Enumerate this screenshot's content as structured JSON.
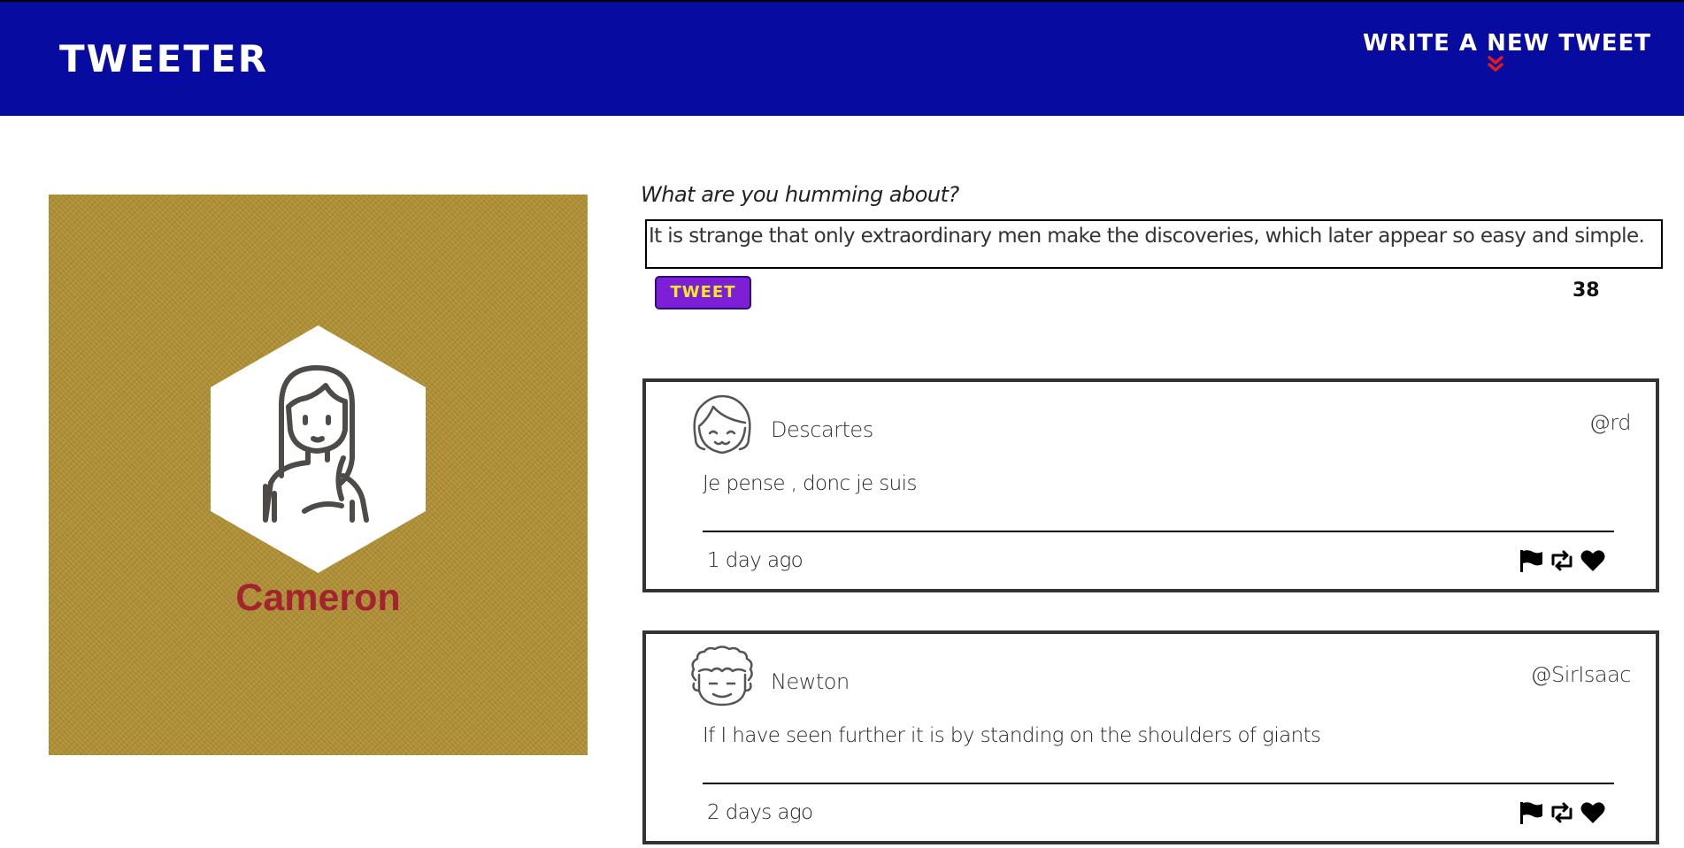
{
  "nav": {
    "brand": "TWEETER",
    "compose_toggle_label": "WRITE A NEW TWEET",
    "compose_toggle_icon": "double-chevron-down-icon",
    "accent_color": "#e01b1b"
  },
  "colors": {
    "nav_bg": "#070ba0",
    "profile_bg": "#b08f33",
    "profile_name": "#a3232f",
    "tweet_button_bg": "#7d1fd6",
    "tweet_button_text": "#f6ea1f"
  },
  "profile": {
    "name": "Cameron",
    "avatar_icon": "woman-long-hair-avatar-icon"
  },
  "compose": {
    "label": "What are you humming about?",
    "input_value": "It is strange that only extraordinary men make the discoveries, which later appear so easy and simple.",
    "button_label": "TWEET",
    "char_counter": "38"
  },
  "tweets": [
    {
      "name": "Descartes",
      "handle": "@rd",
      "avatar_icon": "bob-haircut-avatar-icon",
      "body": "Je pense , donc je suis",
      "time": "1 day ago",
      "actions": [
        "flag-icon",
        "retweet-icon",
        "heart-icon"
      ]
    },
    {
      "name": "Newton",
      "handle": "@SirIsaac",
      "avatar_icon": "curly-hair-avatar-icon",
      "body": "If I have seen further it is by standing on the shoulders of giants",
      "time": "2 days ago",
      "actions": [
        "flag-icon",
        "retweet-icon",
        "heart-icon"
      ]
    }
  ]
}
